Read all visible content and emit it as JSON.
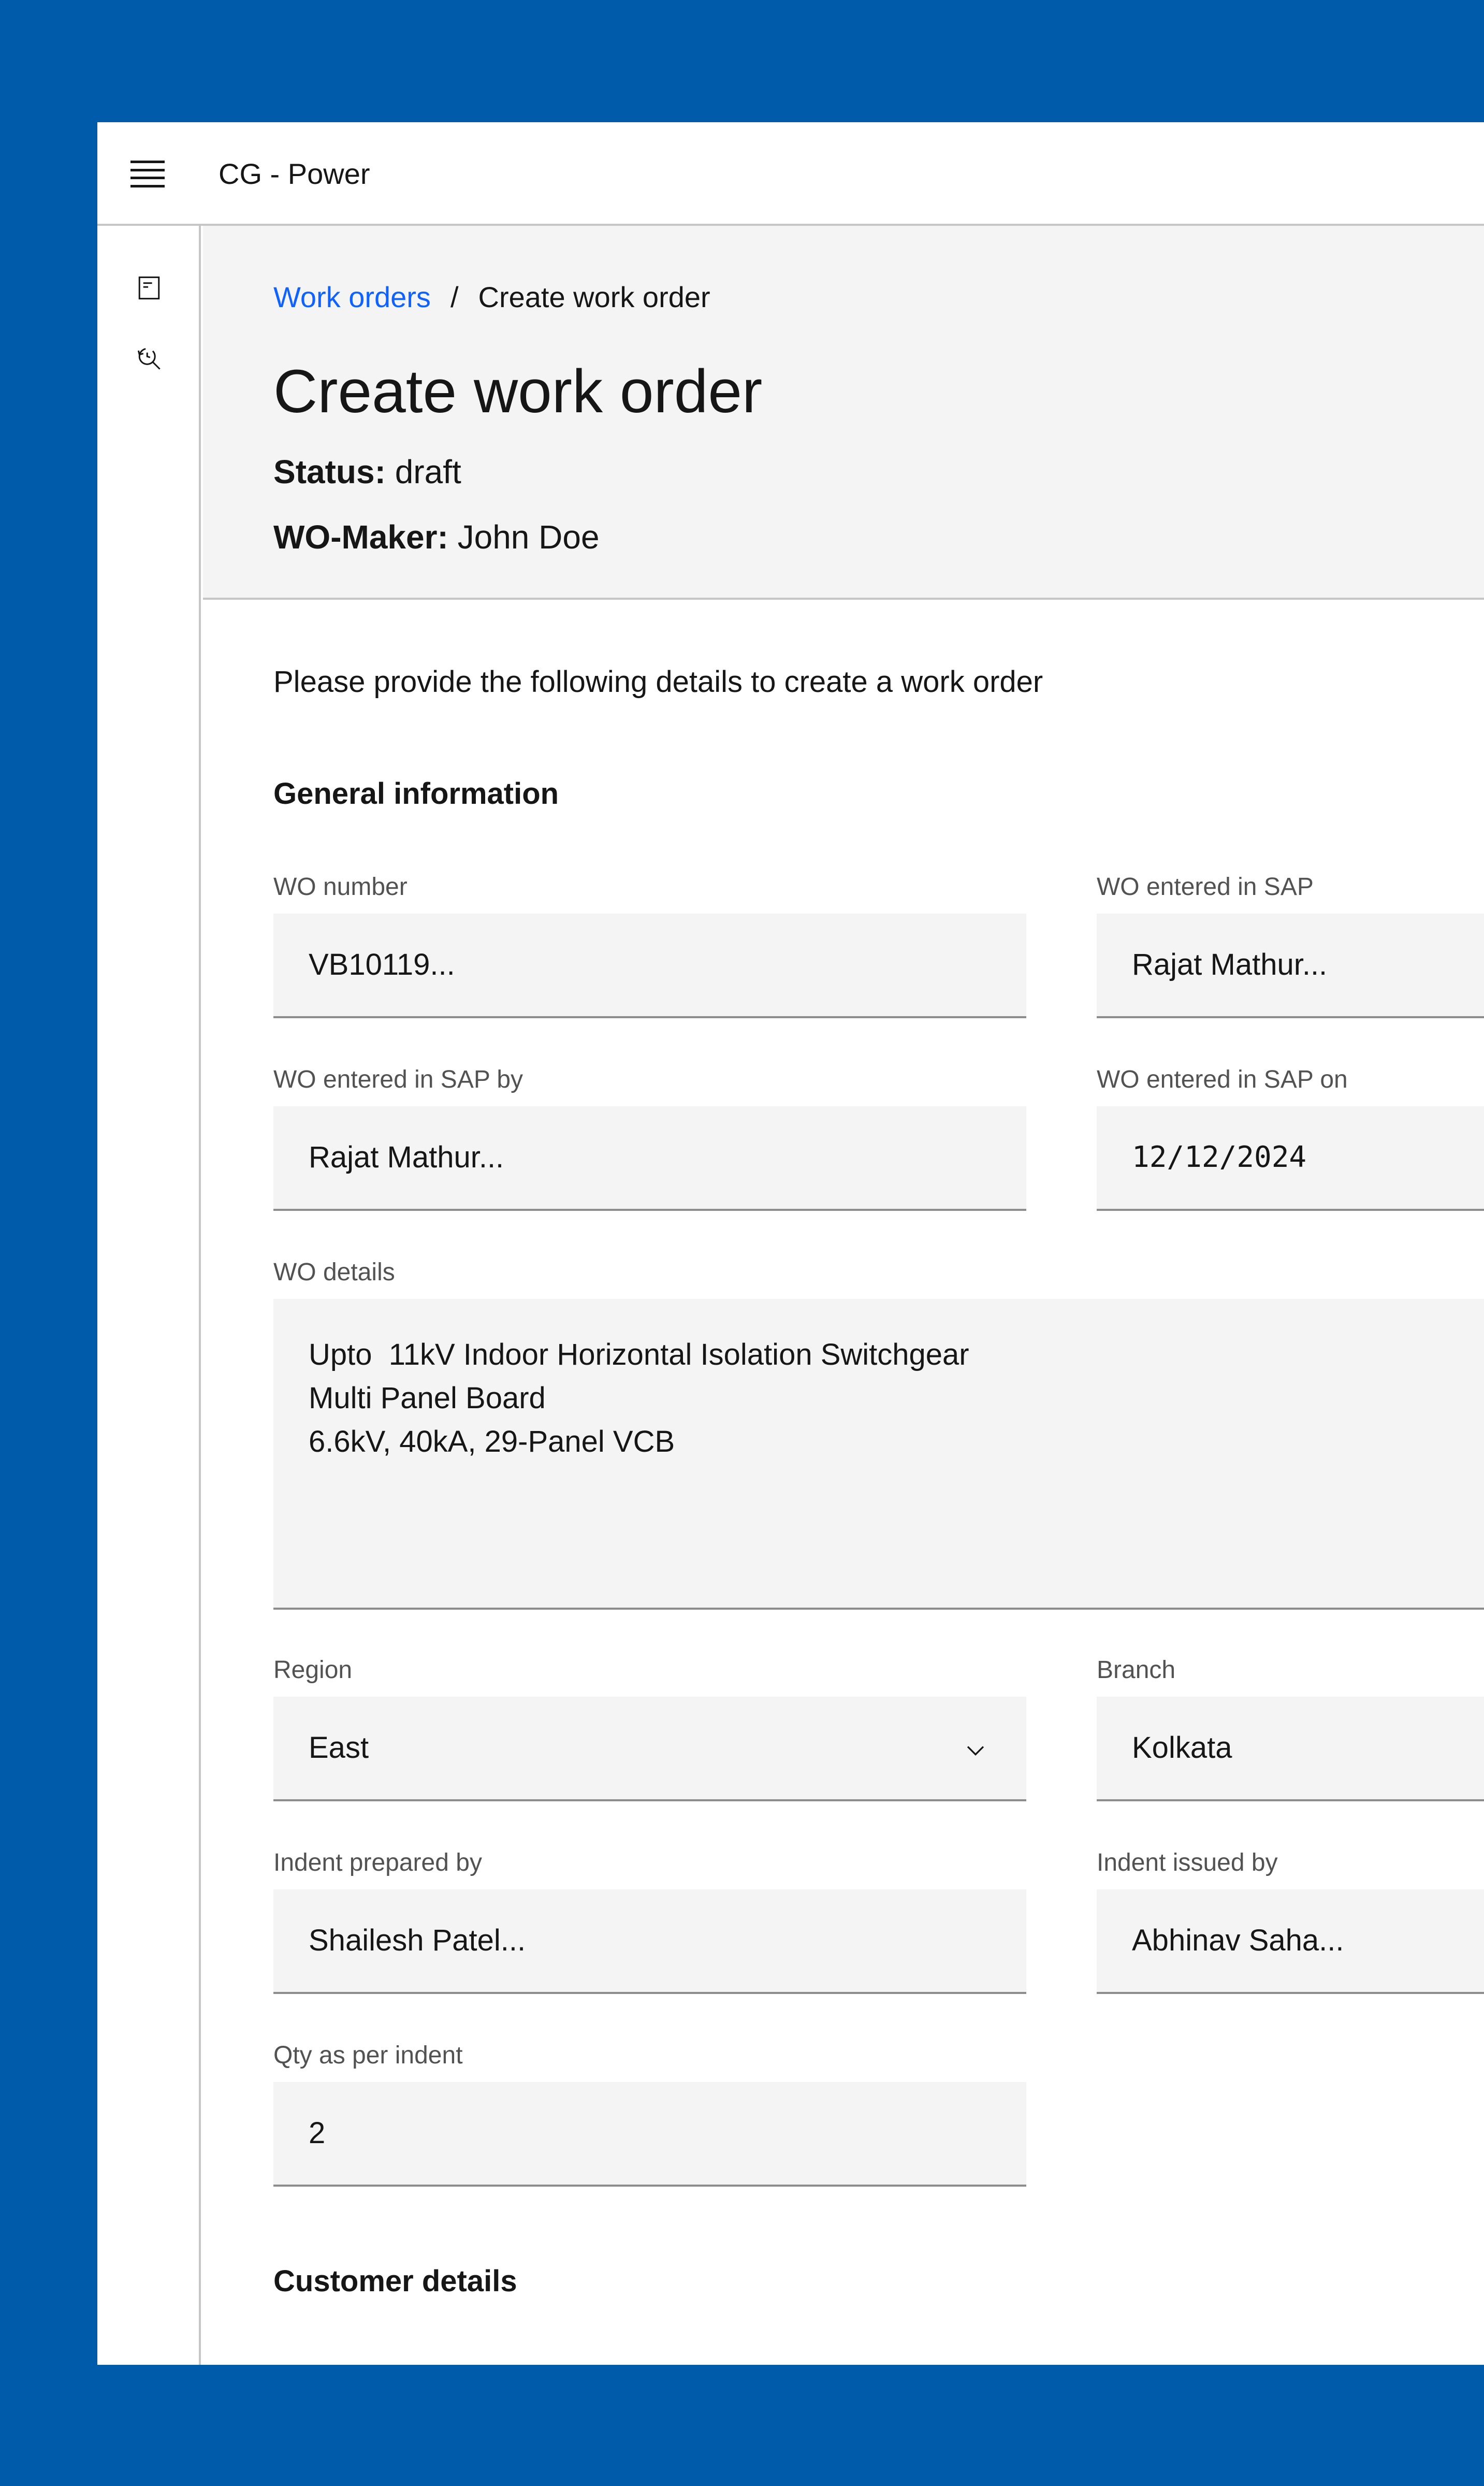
{
  "colors": {
    "background": "#005bab",
    "link": "#0f62fe",
    "field_bg": "#f4f4f4",
    "header_bg": "#f4f4f4"
  },
  "topbar": {
    "menu_icon": "hamburger-menu-icon",
    "app_title": "CG - Power"
  },
  "siderail": {
    "items": [
      {
        "icon": "document-icon"
      },
      {
        "icon": "search-history-icon"
      }
    ]
  },
  "breadcrumb": {
    "link": "Work orders",
    "separator": "/",
    "current": "Create work order"
  },
  "header": {
    "title": "Create work order",
    "status_label": "Status:",
    "status_value": "draft",
    "maker_label": "WO-Maker:",
    "maker_value": "John Doe"
  },
  "form": {
    "intro": "Please provide the following details to create a work order",
    "general_title": "General information",
    "wo_number": {
      "label": "WO number",
      "value": "VB10119..."
    },
    "wo_entered_sap": {
      "label": "WO entered in SAP",
      "value": "Rajat Mathur..."
    },
    "wo_entered_sap_by": {
      "label": "WO entered in SAP  by",
      "value": "Rajat Mathur..."
    },
    "wo_entered_sap_on": {
      "label": "WO entered in SAP  on",
      "value": "12/12/2024"
    },
    "wo_details": {
      "label": "WO details",
      "lines": [
        "Upto  11kV Indoor Horizontal Isolation Switchgear",
        "Multi Panel Board",
        "6.6kV, 40kA, 29-Panel VCB"
      ]
    },
    "region": {
      "label": "Region",
      "value": "East",
      "icon": "chevron-down-icon"
    },
    "branch": {
      "label": "Branch",
      "value": "Kolkata"
    },
    "indent_prepared_by": {
      "label": "Indent prepared by",
      "value": "Shailesh Patel..."
    },
    "indent_issued_by": {
      "label": "Indent issued by",
      "value": "Abhinav Saha..."
    },
    "qty": {
      "label": "Qty as per indent",
      "value": "2"
    },
    "customer_title": "Customer details"
  }
}
